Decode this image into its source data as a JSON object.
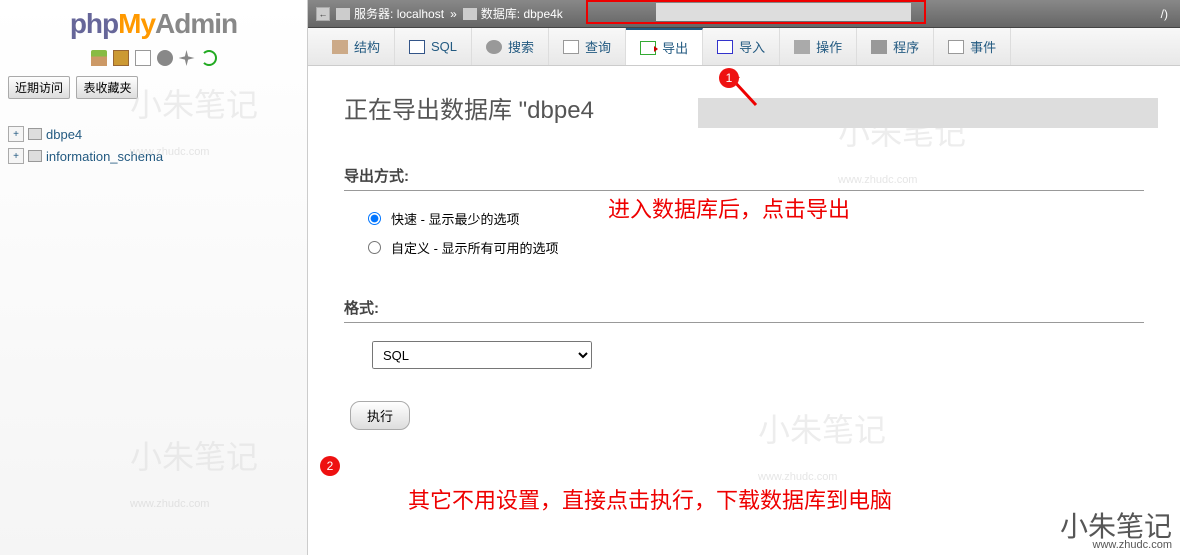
{
  "logo": {
    "php": "php",
    "my": "My",
    "admin": "Admin"
  },
  "recentFav": {
    "recent": "近期访问",
    "favorites": "表收藏夹"
  },
  "dbTree": [
    {
      "name": "dbpe4"
    },
    {
      "name": "information_schema"
    }
  ],
  "breadcrumb": {
    "serverLabel": "服务器:",
    "serverValue": "localhost",
    "sep": "»",
    "dbLabel": "数据库:",
    "dbValue": "dbpe4k",
    "trail": "/)"
  },
  "tabs": {
    "struct": "结构",
    "sql": "SQL",
    "search": "搜索",
    "query": "查询",
    "export": "导出",
    "import": "导入",
    "ops": "操作",
    "proc": "程序",
    "event": "事件"
  },
  "title": "正在导出数据库 \"dbpe4",
  "exportMethod": {
    "label": "导出方式:",
    "quick": "快速 - 显示最少的选项",
    "custom": "自定义 - 显示所有可用的选项"
  },
  "format": {
    "label": "格式:",
    "selected": "SQL"
  },
  "go": "执行",
  "annotations": {
    "top": "进入数据库后，点击导出",
    "bottom": "其它不用设置，直接点击执行，下载数据库到电脑",
    "badge1": "1",
    "badge2": "2"
  },
  "watermark": {
    "name": "小朱笔记",
    "url": "www.zhudc.com"
  }
}
